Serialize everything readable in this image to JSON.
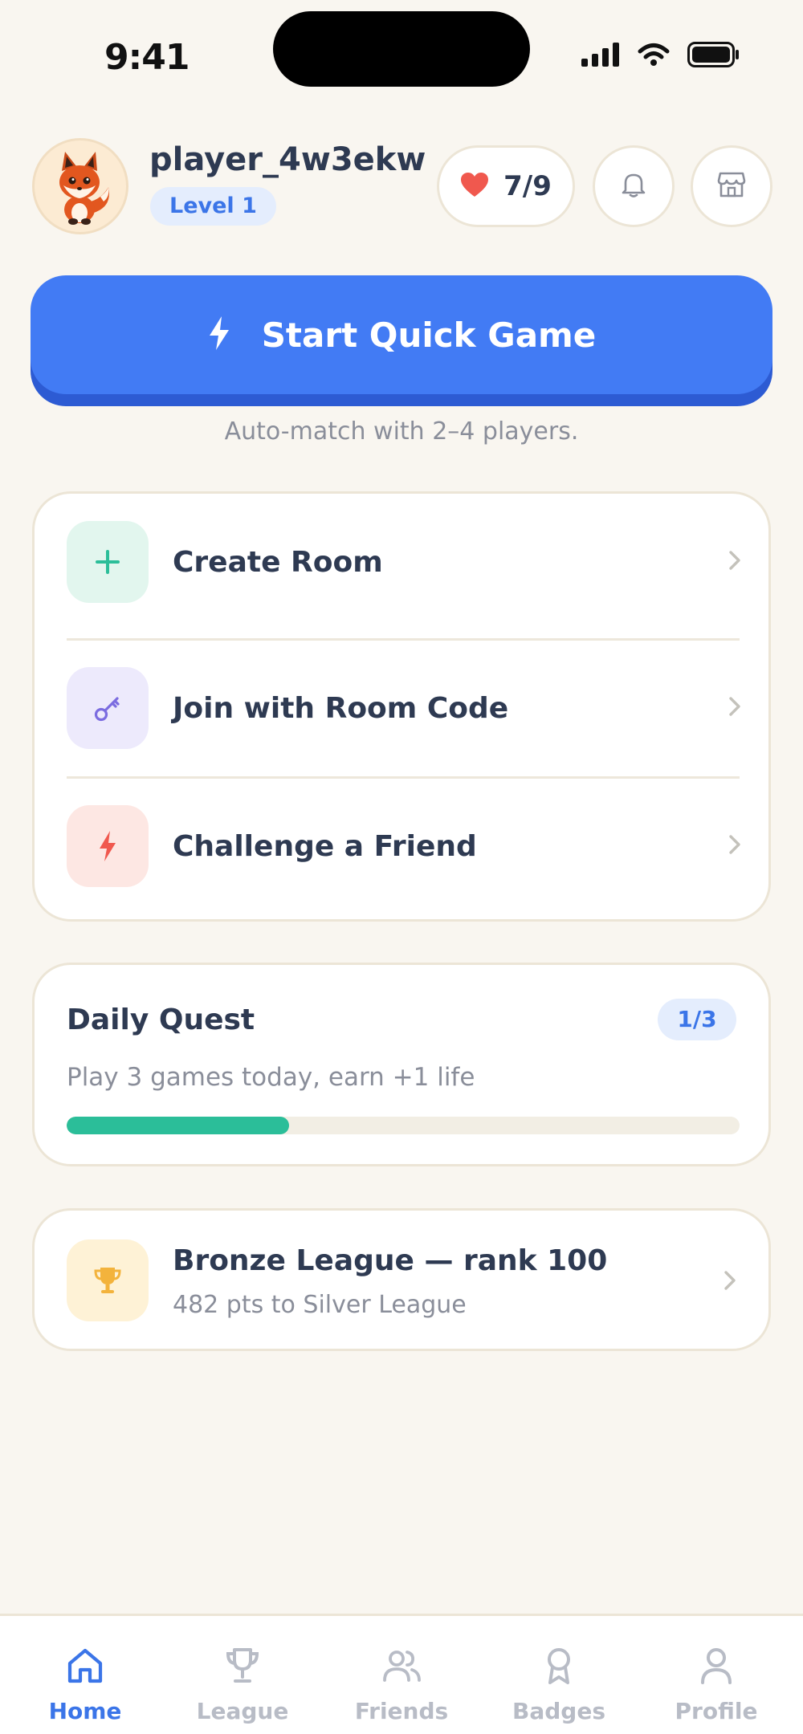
{
  "status_bar": {
    "time": "9:41"
  },
  "profile": {
    "username": "player_4w3ekw",
    "level": "Level 1"
  },
  "lives": {
    "value": "7/9"
  },
  "quick_game": {
    "label": "Start Quick Game",
    "subtitle": "Auto-match with 2–4 players."
  },
  "menu": {
    "items": [
      {
        "label": "Create Room",
        "icon": "plus-icon",
        "color": "#2BBE99"
      },
      {
        "label": "Join with Room Code",
        "icon": "key-icon",
        "color": "#7B6CE0"
      },
      {
        "label": "Challenge a Friend",
        "icon": "bolt-icon",
        "color": "#F0584E"
      }
    ]
  },
  "daily_quest": {
    "title": "Daily Quest",
    "count": "1/3",
    "description": "Play 3 games today, earn +1 life",
    "progress": 0.33
  },
  "league": {
    "title": "Bronze League — rank 100",
    "subtitle": "482 pts to Silver League"
  },
  "tabs": [
    {
      "label": "Home",
      "icon": "home-icon",
      "active": true
    },
    {
      "label": "League",
      "icon": "trophy-icon",
      "active": false
    },
    {
      "label": "Friends",
      "icon": "friends-icon",
      "active": false
    },
    {
      "label": "Badges",
      "icon": "badge-icon",
      "active": false
    },
    {
      "label": "Profile",
      "icon": "person-icon",
      "active": false
    }
  ],
  "colors": {
    "accent": "#427BF4",
    "background": "#F9F6F0",
    "success": "#2BBE99",
    "heart": "#F0584E"
  }
}
